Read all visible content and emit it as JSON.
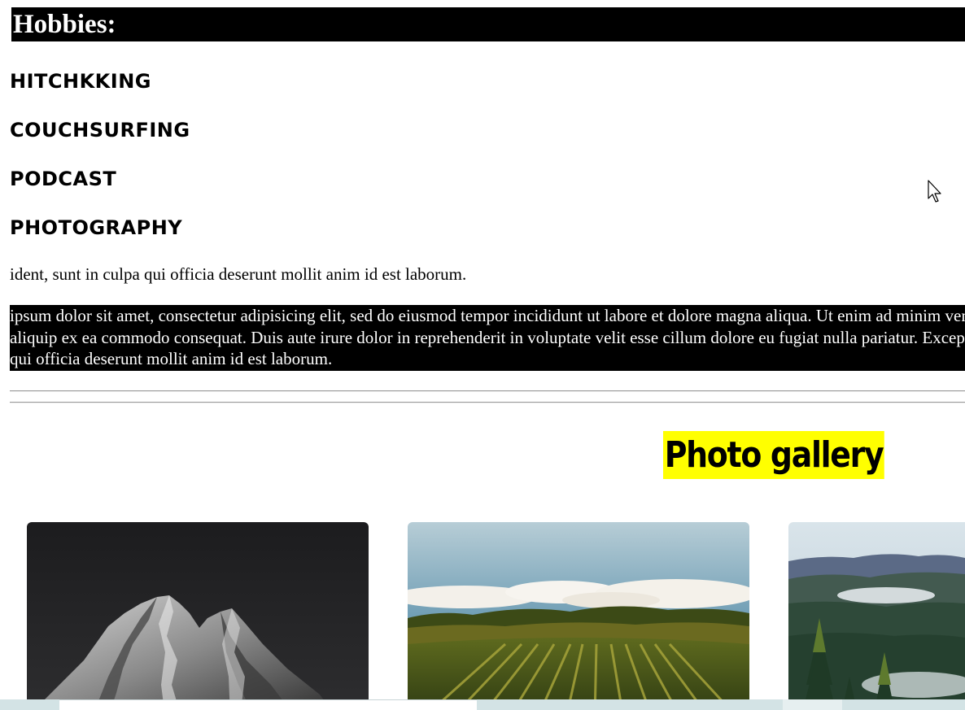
{
  "hobbies": {
    "heading": "Hobbies:",
    "items": [
      "Hitchkking",
      "Couchsurfing",
      "Podcast",
      "Photography"
    ]
  },
  "plain_paragraph": "ident, sunt in culpa qui officia deserunt mollit anim id est laborum.",
  "dark_paragraph": {
    "lines": [
      "ipsum dolor sit amet, consectetur adipisicing elit, sed do eiusmod tempor incididunt ut labore et dolore magna aliqua. Ut enim ad minim veniam, quis nostrud exercitation ullamco laboris nisi ut",
      "aliquip ex ea commodo consequat. Duis aute irure dolor in reprehenderit in voluptate velit esse cillum dolore eu fugiat nulla pariatur. Excepteur sint occaecat cupidatat non proident, sunt in culpa",
      "qui officia deserunt mollit anim id est laborum."
    ]
  },
  "gallery": {
    "title": "Photo gallery",
    "photos": [
      {
        "name": "mountain-photo"
      },
      {
        "name": "vineyard-photo"
      },
      {
        "name": "forest-valley-photo"
      }
    ]
  },
  "colors": {
    "header_bg": "#000000",
    "header_text": "#ffffff",
    "gallery_title_bg": "#ffff00",
    "bottom_strip": "#d3e3e5"
  }
}
